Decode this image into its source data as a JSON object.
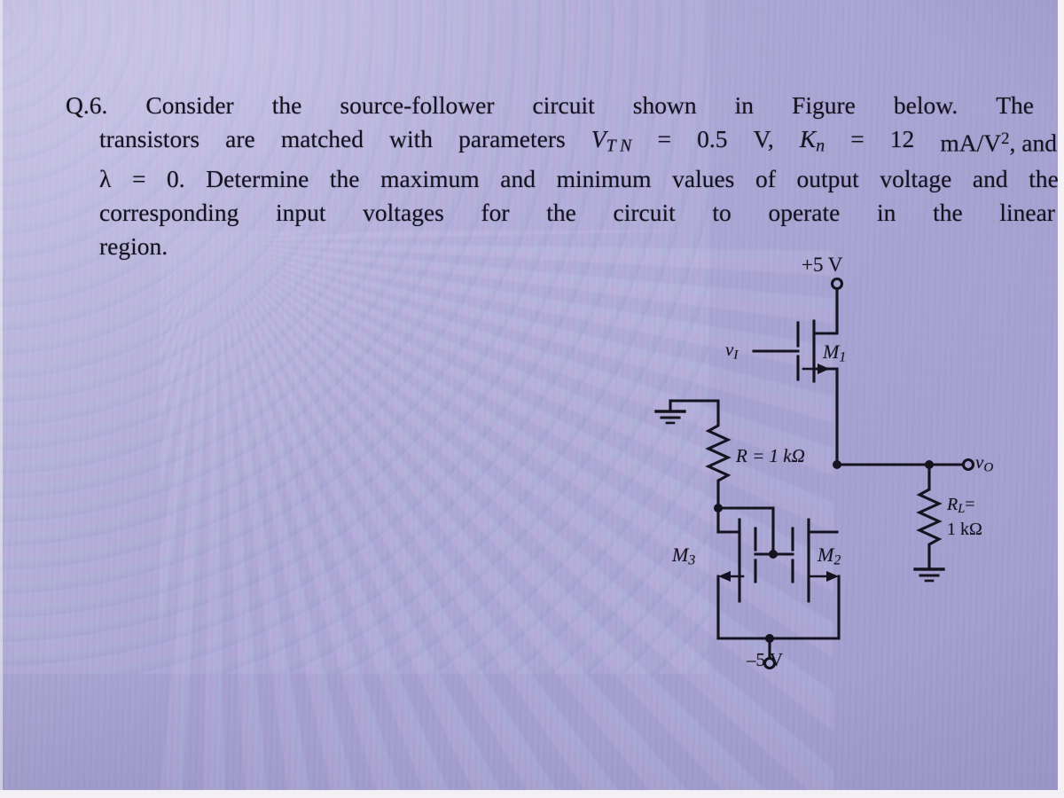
{
  "question": {
    "number": "Q.6.",
    "line1_parts": [
      "Consider",
      "the",
      "source-follower",
      "circuit",
      "shown",
      "in",
      "Figure",
      "below.",
      "The"
    ],
    "line2_pre": "transistors are matched with parameters",
    "line2_parts": [
      "transistors",
      "are",
      "matched",
      "with",
      "parameters"
    ],
    "param1_symbol": "V",
    "param1_sub": "T N",
    "param1_eq": "=",
    "param1_value": "0.5",
    "param1_unit": "V,",
    "param2_symbol": "K",
    "param2_sub": "n",
    "param2_eq": "=",
    "param2_value": "12",
    "param2_unit": "mA/V",
    "param2_unit_sup": "2",
    "param2_tail": ", and",
    "line3_lambda": "λ",
    "line3_eq": "=",
    "line3_val": "0.",
    "line3_parts": [
      "Determine",
      "the",
      "maximum",
      "and",
      "minimum",
      "values",
      "of",
      "output",
      "voltage",
      "and",
      "the"
    ],
    "line4_parts": [
      "corresponding",
      "input",
      "voltages",
      "for",
      "the",
      "circuit",
      "to",
      "operate",
      "in",
      "the",
      "linear"
    ],
    "line5": "region."
  },
  "circuit": {
    "title": "source-follower-circuit",
    "supply_positive": "+5 V",
    "supply_negative": "–5 V",
    "input_label_symbol": "v",
    "input_label_sub": "I",
    "output_label_symbol": "v",
    "output_label_sub": "O",
    "transistor_m1_symbol": "M",
    "transistor_m1_sub": "1",
    "transistor_m2_symbol": "M",
    "transistor_m2_sub": "2",
    "transistor_m3_symbol": "M",
    "transistor_m3_sub": "3",
    "resistor_r_label": "R = 1 kΩ",
    "resistor_rl_symbol": "R",
    "resistor_rl_sub": "L",
    "resistor_rl_eq": "=",
    "resistor_rl_value": "1 kΩ",
    "ground_symbol": "ground-icon",
    "wire_color": "#15131f"
  },
  "colors": {
    "background": "#a39ece",
    "ink": "#15131f",
    "page_edge": "#f4f2f6"
  }
}
